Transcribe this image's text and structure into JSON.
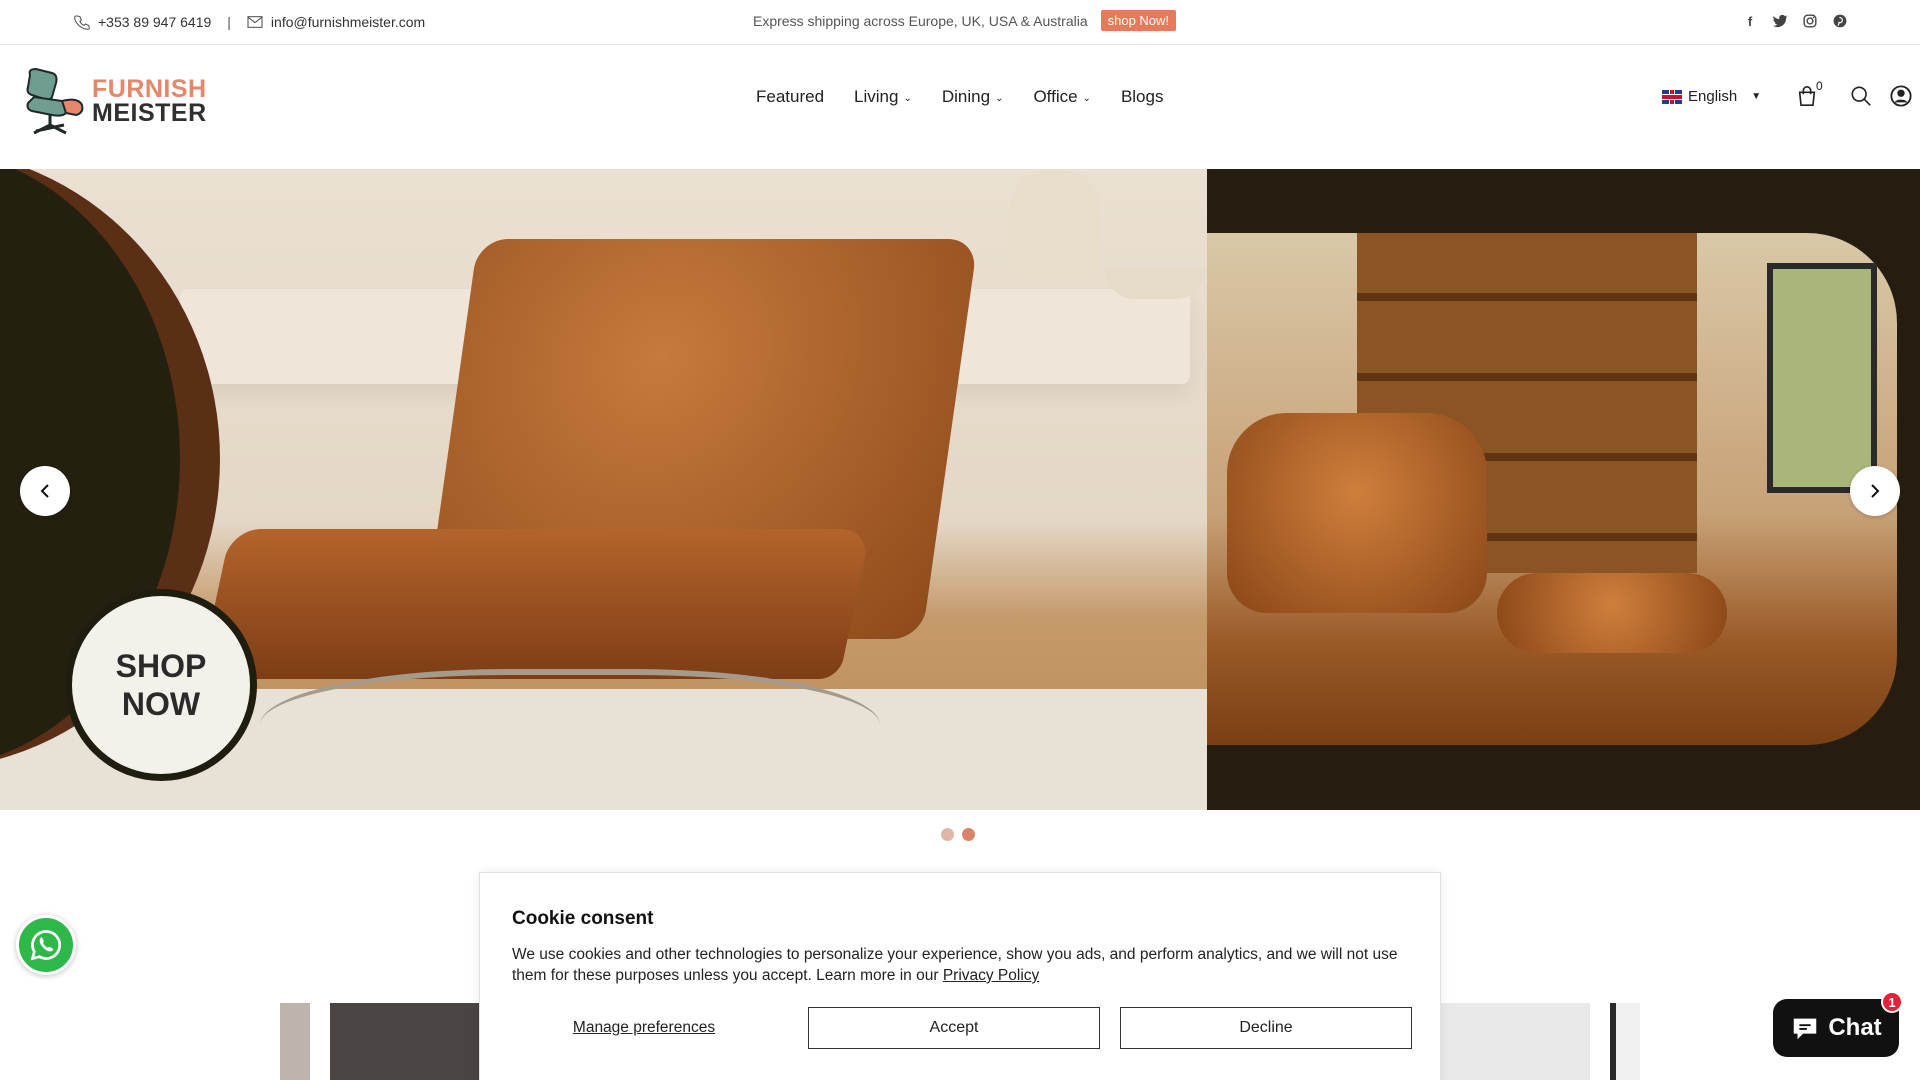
{
  "topbar": {
    "phone": "+353 89 947 6419",
    "separator": "|",
    "email": "info@furnishmeister.com",
    "promo_text": "Express shipping across Europe, UK, USA & Australia",
    "promo_button": "shop Now!",
    "social_icons": [
      "facebook-icon",
      "twitter-icon",
      "instagram-icon",
      "pinterest-icon"
    ]
  },
  "header": {
    "logo_line1": "FURNISH",
    "logo_line2": "MEISTER",
    "nav": [
      {
        "label": "Featured",
        "has_dropdown": false
      },
      {
        "label": "Living",
        "has_dropdown": true
      },
      {
        "label": "Dining",
        "has_dropdown": true
      },
      {
        "label": "Office",
        "has_dropdown": true
      },
      {
        "label": "Blogs",
        "has_dropdown": false
      }
    ],
    "language": "English",
    "cart_count": "0"
  },
  "hero": {
    "cta_line1": "SHOP",
    "cta_line2": "NOW",
    "slides_total": 2,
    "active_slide": 2
  },
  "cookie": {
    "title": "Cookie consent",
    "body": "We use cookies and other technologies to personalize your experience, show you ads, and perform analytics, and we will not use them for these purposes unless you accept. Learn more in our",
    "policy_link": "Privacy Policy",
    "manage": "Manage preferences",
    "accept": "Accept",
    "decline": "Decline"
  },
  "chat": {
    "label": "Chat",
    "badge": "1"
  },
  "colors": {
    "accent": "#e8795b",
    "logo_accent": "#e4876a",
    "hero_dark": "#251e10",
    "whatsapp": "#2fb84a"
  }
}
